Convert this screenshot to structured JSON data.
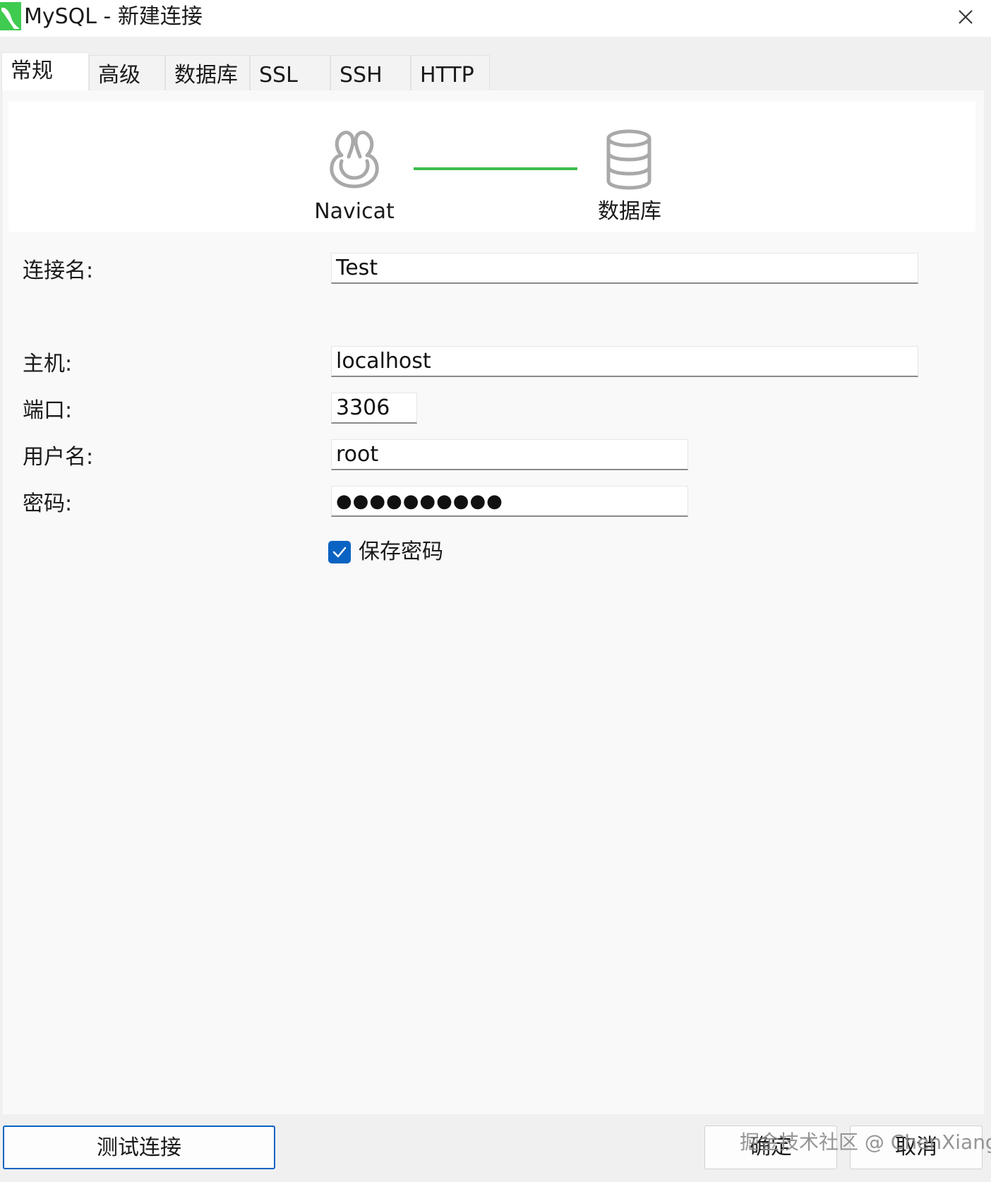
{
  "window": {
    "title": "MySQL - 新建连接"
  },
  "tabs": [
    {
      "label": "常规",
      "active": true
    },
    {
      "label": "高级"
    },
    {
      "label": "数据库"
    },
    {
      "label": "SSL"
    },
    {
      "label": "SSH"
    },
    {
      "label": "HTTP"
    }
  ],
  "diagram": {
    "left_label": "Navicat",
    "right_label": "数据库",
    "line_color": "#3fbd4d",
    "left_icon": "navicat-logo-icon",
    "right_icon": "database-icon"
  },
  "form": {
    "connection_name_label": "连接名:",
    "connection_name_value": "Test",
    "host_label": "主机:",
    "host_value": "localhost",
    "port_label": "端口:",
    "port_value": "3306",
    "username_label": "用户名:",
    "username_value": "root",
    "password_label": "密码:",
    "password_value": "●●●●●●●●●●",
    "save_password_label": "保存密码",
    "save_password_checked": true
  },
  "buttons": {
    "test_connection": "测试连接",
    "ok": "确定",
    "cancel": "取消"
  },
  "watermark": "掘金技术社区 @ ChenXiang",
  "colors": {
    "accent": "#0a63c2",
    "app_icon": "#3fcb4f"
  }
}
